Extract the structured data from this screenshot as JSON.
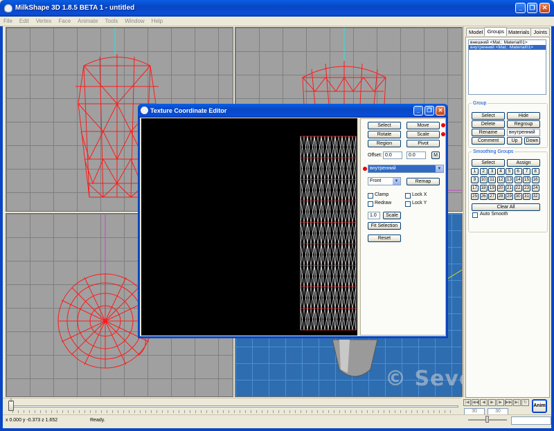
{
  "window": {
    "title": "MilkShape 3D 1.8.5 BETA 1 - untitled",
    "min": "_",
    "max": "❐",
    "close": "✕"
  },
  "menu": [
    "File",
    "Edit",
    "Vertex",
    "Face",
    "Animate",
    "Tools",
    "Window",
    "Help"
  ],
  "tabs": [
    "Model",
    "Groups",
    "Materials",
    "Joints"
  ],
  "groups": {
    "list": [
      "внешний <Mat.: Material01>",
      "внутренний <Mat.: Material01>"
    ],
    "legend": "Group",
    "select": "Select",
    "hide": "Hide",
    "delete": "Delete",
    "regroup": "Regroup",
    "rename": "Rename",
    "rename_value": "внутренний",
    "comment": "Comment",
    "up": "Up",
    "down": "Down"
  },
  "smoothing": {
    "legend": "Smoothing Groups",
    "select": "Select",
    "assign": "Assign",
    "numbers": [
      "1",
      "2",
      "3",
      "4",
      "5",
      "6",
      "7",
      "8",
      "9",
      "10",
      "11",
      "12",
      "13",
      "14",
      "15",
      "16",
      "17",
      "18",
      "19",
      "20",
      "21",
      "22",
      "23",
      "24",
      "25",
      "26",
      "27",
      "28",
      "29",
      "30",
      "31",
      "32"
    ],
    "clear_all": "Clear All",
    "auto_smooth": "Auto Smooth"
  },
  "tce": {
    "title": "Texture Coordinate Editor",
    "select": "Select",
    "move": "Move",
    "rotate": "Rotate",
    "scale": "Scale",
    "region": "Region",
    "pivot": "Pivot",
    "offset_label": "Offset:",
    "offset_x": "0.0",
    "offset_y": "0.0",
    "m": "M",
    "group": "внутренний",
    "projection": "Front",
    "remap": "Remap",
    "clamp": "Clamp",
    "lock_x": "Lock X",
    "redraw": "Redraw",
    "lock_y": "Lock Y",
    "scale_value": "1.0",
    "scale_btn": "Scale",
    "fit_selection": "Fit Selection",
    "reset": "Reset"
  },
  "timeline": {
    "start": "1",
    "frame_a": "30",
    "frame_b": "30",
    "anim": "Anim"
  },
  "status": {
    "coords": "x 0.000 y -0.373 z 1.652",
    "message": "Ready."
  },
  "watermark": "© Severinka",
  "colors": {
    "wire": "#ff2020",
    "accent": "#0846c4",
    "selection": "#316ac5"
  }
}
